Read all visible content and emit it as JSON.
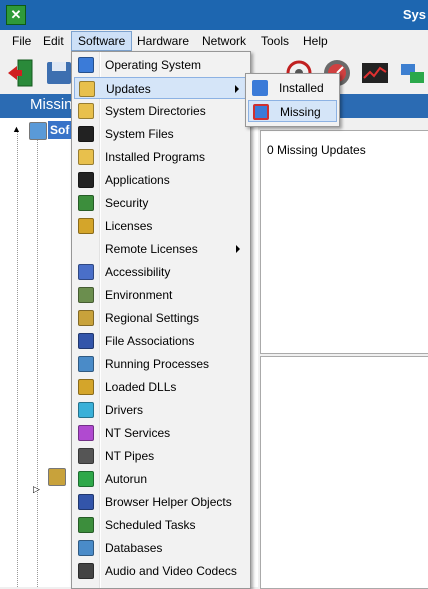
{
  "window": {
    "title": "Sys"
  },
  "menubar": [
    "File",
    "Edit",
    "Software",
    "Hardware",
    "Network",
    "Tools",
    "Help"
  ],
  "header": {
    "title": "Missing"
  },
  "tree": {
    "root_label": "Sof"
  },
  "software_menu": [
    {
      "label": "Operating System",
      "icon": "windows-icon",
      "color": "#3b7bd8"
    },
    {
      "label": "Updates",
      "icon": "folder-icon",
      "color": "#e8c04c",
      "submenu": true
    },
    {
      "label": "System Directories",
      "icon": "folder-icon",
      "color": "#e8c04c"
    },
    {
      "label": "System Files",
      "icon": "console-icon",
      "color": "#222222"
    },
    {
      "label": "Installed Programs",
      "icon": "folder-icon",
      "color": "#e8c04c"
    },
    {
      "label": "Applications",
      "icon": "console-icon",
      "color": "#222222"
    },
    {
      "label": "Security",
      "icon": "shield-icon",
      "color": "#3c8e3c"
    },
    {
      "label": "Licenses",
      "icon": "lock-icon",
      "color": "#d4a52a"
    },
    {
      "label": "Remote Licenses",
      "icon": "blank-icon",
      "color": "#f2f2f2",
      "submenu": true
    },
    {
      "label": "Accessibility",
      "icon": "accessibility-icon",
      "color": "#4a6fc8"
    },
    {
      "label": "Environment",
      "icon": "environment-icon",
      "color": "#6b8e4e"
    },
    {
      "label": "Regional Settings",
      "icon": "font-icon",
      "color": "#c8a23b"
    },
    {
      "label": "File Associations",
      "icon": "font-icon",
      "color": "#3355aa"
    },
    {
      "label": "Running Processes",
      "icon": "process-icon",
      "color": "#4a8bc8"
    },
    {
      "label": "Loaded DLLs",
      "icon": "dll-icon",
      "color": "#d4a52a"
    },
    {
      "label": "Drivers",
      "icon": "gear-icon",
      "color": "#3ab0d8"
    },
    {
      "label": "NT Services",
      "icon": "gear-icon",
      "color": "#b04ad0"
    },
    {
      "label": "NT Pipes",
      "icon": "pipe-icon",
      "color": "#555555"
    },
    {
      "label": "Autorun",
      "icon": "autorun-icon",
      "color": "#2fa84a"
    },
    {
      "label": "Browser Helper Objects",
      "icon": "bho-icon",
      "color": "#3355aa"
    },
    {
      "label": "Scheduled Tasks",
      "icon": "task-icon",
      "color": "#3c8e3c"
    },
    {
      "label": "Databases",
      "icon": "database-icon",
      "color": "#4a8bc8"
    },
    {
      "label": "Audio and Video Codecs",
      "icon": "codec-icon",
      "color": "#444444"
    }
  ],
  "updates_menu": [
    {
      "label": "Installed",
      "icon": "windows-icon"
    },
    {
      "label": "Missing",
      "icon": "missing-update-icon"
    }
  ],
  "content": {
    "missing_count_text": "0 Missing Updates"
  },
  "colors": {
    "titlebar": "#1d66b0",
    "header": "#2b6bb3",
    "highlight": "#d5e5f8",
    "highlight_border": "#8db2e3"
  }
}
